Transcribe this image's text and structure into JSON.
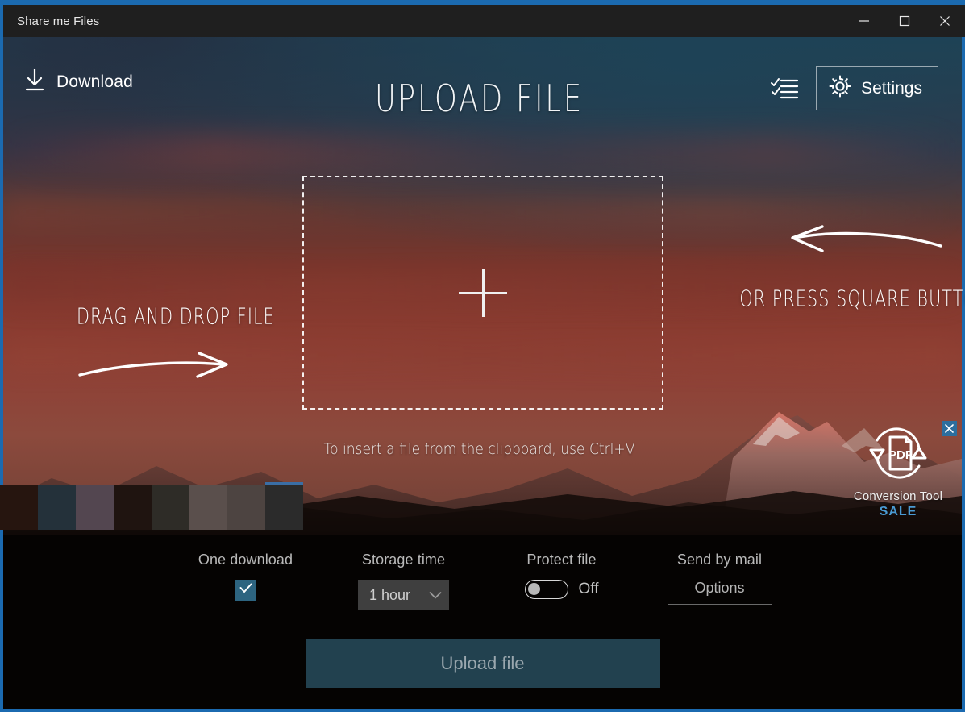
{
  "window": {
    "title": "Share me Files",
    "controls": [
      {
        "name": "minimize",
        "glyph": "minimize-icon"
      },
      {
        "name": "maximize",
        "glyph": "maximize-icon"
      },
      {
        "name": "close",
        "glyph": "close-icon"
      }
    ]
  },
  "header": {
    "download_label": "Download",
    "download_icon": "download-arrow-icon",
    "title": "UPLOAD FILE",
    "checklist_icon": "checklist-icon",
    "settings_label": "Settings",
    "settings_icon": "gear-icon"
  },
  "dropzone": {
    "plus_icon": "plus-icon",
    "hint_left": "DRAG AND DROP FILE",
    "hint_left_arrow": "arrow-right-hand-drawn-icon",
    "hint_right": "OR PRESS SQUARE BUTTON",
    "hint_right_arrow": "arrow-left-hand-drawn-icon",
    "clipboard_hint": "To insert a file from the clipboard, use Ctrl+V"
  },
  "ad": {
    "title": "Conversion Tool",
    "badge": "SALE",
    "icon": "pdf-conversion-icon",
    "close_icon": "close-icon",
    "close_bg": "#2c6e9e",
    "badge_color": "#4a9bd4"
  },
  "swatches": {
    "colors": [
      "#26150f",
      "#24313a",
      "#534650",
      "#1f1410",
      "#2e2c27",
      "#5a4f4c",
      "#4d4441",
      "#2b2b2b"
    ],
    "selected_index": 7,
    "selected_accent": "#3a6ea5"
  },
  "options": {
    "one_download": {
      "label": "One download",
      "checked": true,
      "check_icon": "checkmark-icon",
      "accent": "#2d6480"
    },
    "storage_time": {
      "label": "Storage time",
      "value": "1 hour",
      "chevron_icon": "chevron-down-icon"
    },
    "protect_file": {
      "label": "Protect file",
      "state": "Off",
      "enabled": false
    },
    "send_by_mail": {
      "label": "Send by mail",
      "options_label": "Options"
    }
  },
  "footer": {
    "upload_label": "Upload file",
    "upload_bg": "#22414f"
  }
}
